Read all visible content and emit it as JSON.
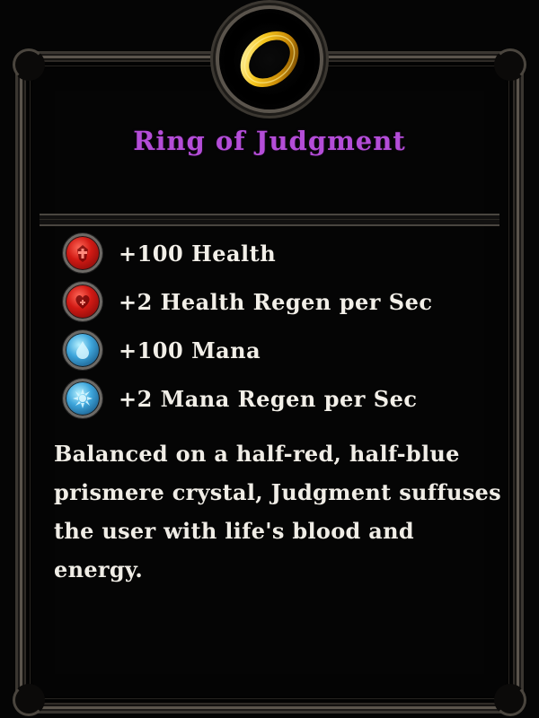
{
  "item": {
    "name": "Ring of Judgment",
    "icon": "gold-ring-icon",
    "name_color": "#b44dd8"
  },
  "stats": [
    {
      "text": "+100 Health",
      "icon": "health-orb-icon",
      "color": "#d21a14"
    },
    {
      "text": "+2 Health Regen per Sec",
      "icon": "health-regen-orb-icon",
      "color": "#d21a14"
    },
    {
      "text": "+100 Mana",
      "icon": "mana-orb-icon",
      "color": "#3ea6dc"
    },
    {
      "text": "+2 Mana Regen per Sec",
      "icon": "mana-regen-orb-icon",
      "color": "#3ea6dc"
    }
  ],
  "description": "Balanced on a half-red, half-blue prismere crystal, Judgment suffuses the user with life's blood and energy."
}
